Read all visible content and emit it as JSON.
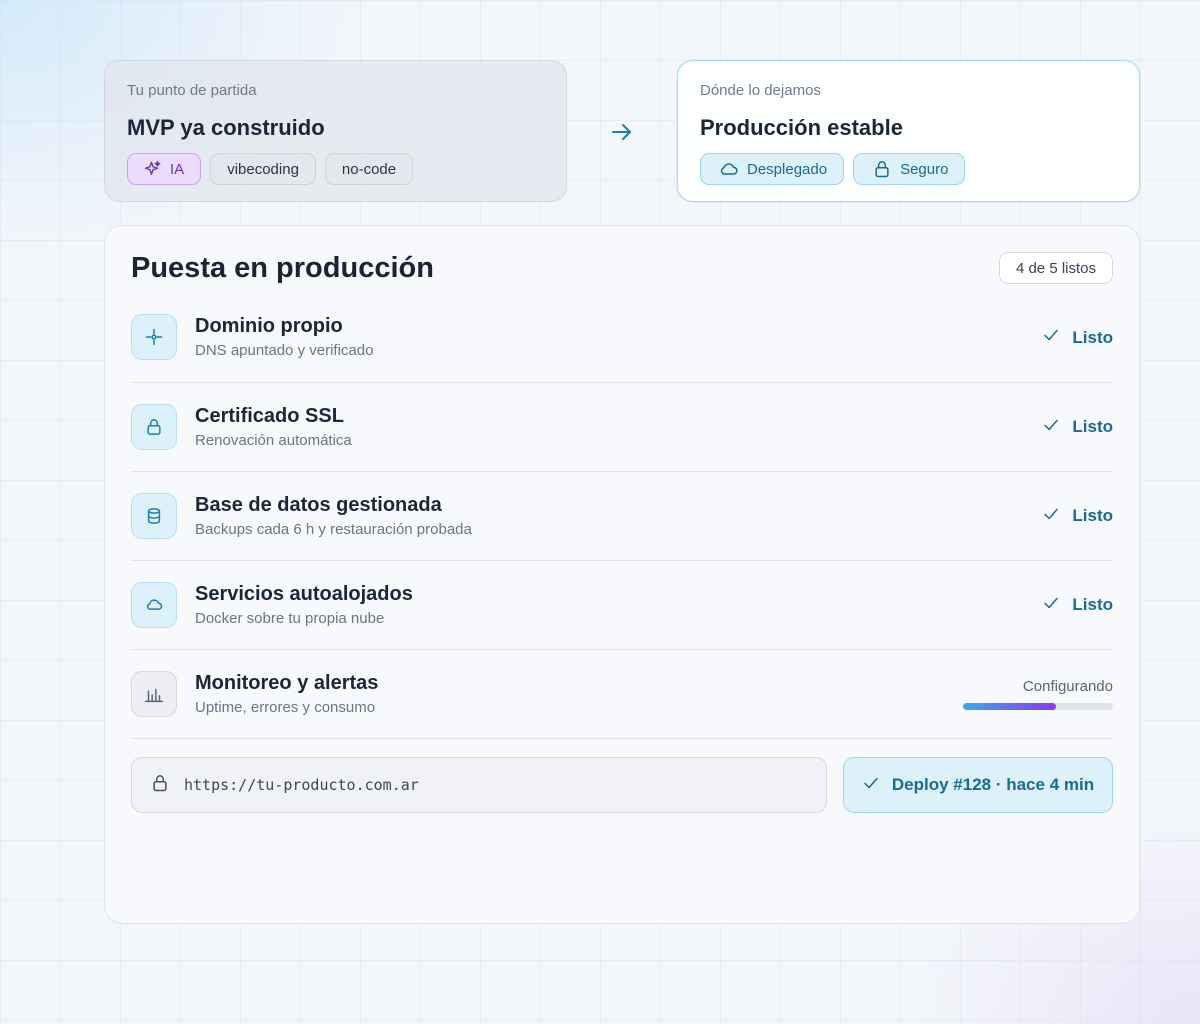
{
  "start_card": {
    "eyebrow": "Tu punto de partida",
    "title": "MVP ya construido",
    "tags": [
      {
        "label": "IA",
        "icon": "sparkles-icon"
      },
      {
        "label": "vibecoding"
      },
      {
        "label": "no-code"
      }
    ]
  },
  "end_card": {
    "eyebrow": "Dónde lo dejamos",
    "title": "Producción estable",
    "tags": [
      {
        "label": "Desplegado",
        "icon": "cloud-icon"
      },
      {
        "label": "Seguro",
        "icon": "lock-icon"
      }
    ]
  },
  "panel": {
    "title": "Puesta en producción",
    "progress_badge": "4 de 5 listos",
    "items": [
      {
        "title": "Dominio propio",
        "subtitle": "DNS apuntado y verificado",
        "status": "Listo",
        "icon": "crosshair-icon"
      },
      {
        "title": "Certificado SSL",
        "subtitle": "Renovación automática",
        "status": "Listo",
        "icon": "lock-icon"
      },
      {
        "title": "Base de datos gestionada",
        "subtitle": "Backups cada 6 h y restauración probada",
        "status": "Listo",
        "icon": "database-icon"
      },
      {
        "title": "Servicios autoalojados",
        "subtitle": "Docker sobre tu propia nube",
        "status": "Listo",
        "icon": "cloud-icon"
      },
      {
        "title": "Monitoreo y alertas",
        "subtitle": "Uptime, errores y consumo",
        "status": "Configurando",
        "icon": "bar-chart-icon",
        "progress": 0.62
      }
    ],
    "url": "https://tu-producto.com.ar",
    "deploy_label": "Deploy #128 · hace 4 min"
  },
  "colors": {
    "accent": "#1a6a96",
    "accent_bg": "#ddf1fb",
    "ia_purple": "#6b2fb8",
    "progress_start": "#3ea7ee",
    "progress_end": "#8b3ae8"
  }
}
